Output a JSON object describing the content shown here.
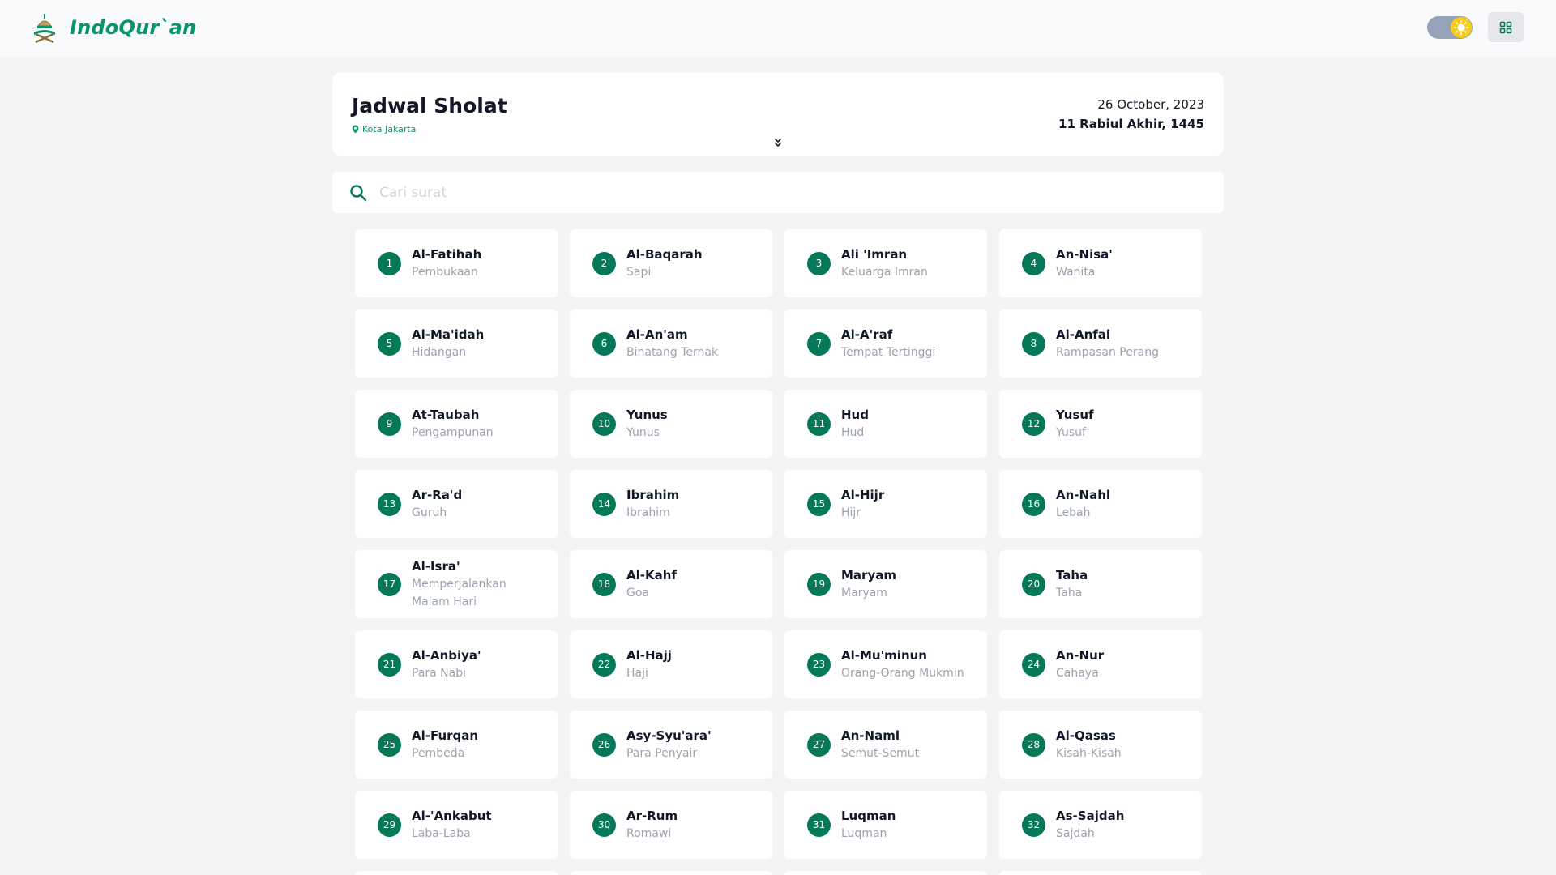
{
  "brand": {
    "name": "IndoQur`an"
  },
  "prayer": {
    "title": "Jadwal Sholat",
    "location": "Kota Jakarta",
    "date": "26 October, 2023",
    "hijri": "11 Rabiul Akhir, 1445"
  },
  "search": {
    "placeholder": "Cari surat",
    "value": ""
  },
  "colors": {
    "accent": "#047857",
    "brand": "#059669",
    "sun": "#facc15"
  },
  "surahs": [
    {
      "num": "1",
      "name": "Al-Fatihah",
      "meaning": "Pembukaan"
    },
    {
      "num": "2",
      "name": "Al-Baqarah",
      "meaning": "Sapi"
    },
    {
      "num": "3",
      "name": "Ali 'Imran",
      "meaning": "Keluarga Imran"
    },
    {
      "num": "4",
      "name": "An-Nisa'",
      "meaning": "Wanita"
    },
    {
      "num": "5",
      "name": "Al-Ma'idah",
      "meaning": "Hidangan"
    },
    {
      "num": "6",
      "name": "Al-An'am",
      "meaning": "Binatang Ternak"
    },
    {
      "num": "7",
      "name": "Al-A'raf",
      "meaning": "Tempat Tertinggi"
    },
    {
      "num": "8",
      "name": "Al-Anfal",
      "meaning": "Rampasan Perang"
    },
    {
      "num": "9",
      "name": "At-Taubah",
      "meaning": "Pengampunan"
    },
    {
      "num": "10",
      "name": "Yunus",
      "meaning": "Yunus"
    },
    {
      "num": "11",
      "name": "Hud",
      "meaning": "Hud"
    },
    {
      "num": "12",
      "name": "Yusuf",
      "meaning": "Yusuf"
    },
    {
      "num": "13",
      "name": "Ar-Ra'd",
      "meaning": "Guruh"
    },
    {
      "num": "14",
      "name": "Ibrahim",
      "meaning": "Ibrahim"
    },
    {
      "num": "15",
      "name": "Al-Hijr",
      "meaning": "Hijr"
    },
    {
      "num": "16",
      "name": "An-Nahl",
      "meaning": "Lebah"
    },
    {
      "num": "17",
      "name": "Al-Isra'",
      "meaning": "Memperjalankan Malam Hari"
    },
    {
      "num": "18",
      "name": "Al-Kahf",
      "meaning": "Goa"
    },
    {
      "num": "19",
      "name": "Maryam",
      "meaning": "Maryam"
    },
    {
      "num": "20",
      "name": "Taha",
      "meaning": "Taha"
    },
    {
      "num": "21",
      "name": "Al-Anbiya'",
      "meaning": "Para Nabi"
    },
    {
      "num": "22",
      "name": "Al-Hajj",
      "meaning": "Haji"
    },
    {
      "num": "23",
      "name": "Al-Mu'minun",
      "meaning": "Orang-Orang Mukmin"
    },
    {
      "num": "24",
      "name": "An-Nur",
      "meaning": "Cahaya"
    },
    {
      "num": "25",
      "name": "Al-Furqan",
      "meaning": "Pembeda"
    },
    {
      "num": "26",
      "name": "Asy-Syu'ara'",
      "meaning": "Para Penyair"
    },
    {
      "num": "27",
      "name": "An-Naml",
      "meaning": "Semut-Semut"
    },
    {
      "num": "28",
      "name": "Al-Qasas",
      "meaning": "Kisah-Kisah"
    },
    {
      "num": "29",
      "name": "Al-'Ankabut",
      "meaning": "Laba-Laba"
    },
    {
      "num": "30",
      "name": "Ar-Rum",
      "meaning": "Romawi"
    },
    {
      "num": "31",
      "name": "Luqman",
      "meaning": "Luqman"
    },
    {
      "num": "32",
      "name": "As-Sajdah",
      "meaning": "Sajdah"
    }
  ]
}
